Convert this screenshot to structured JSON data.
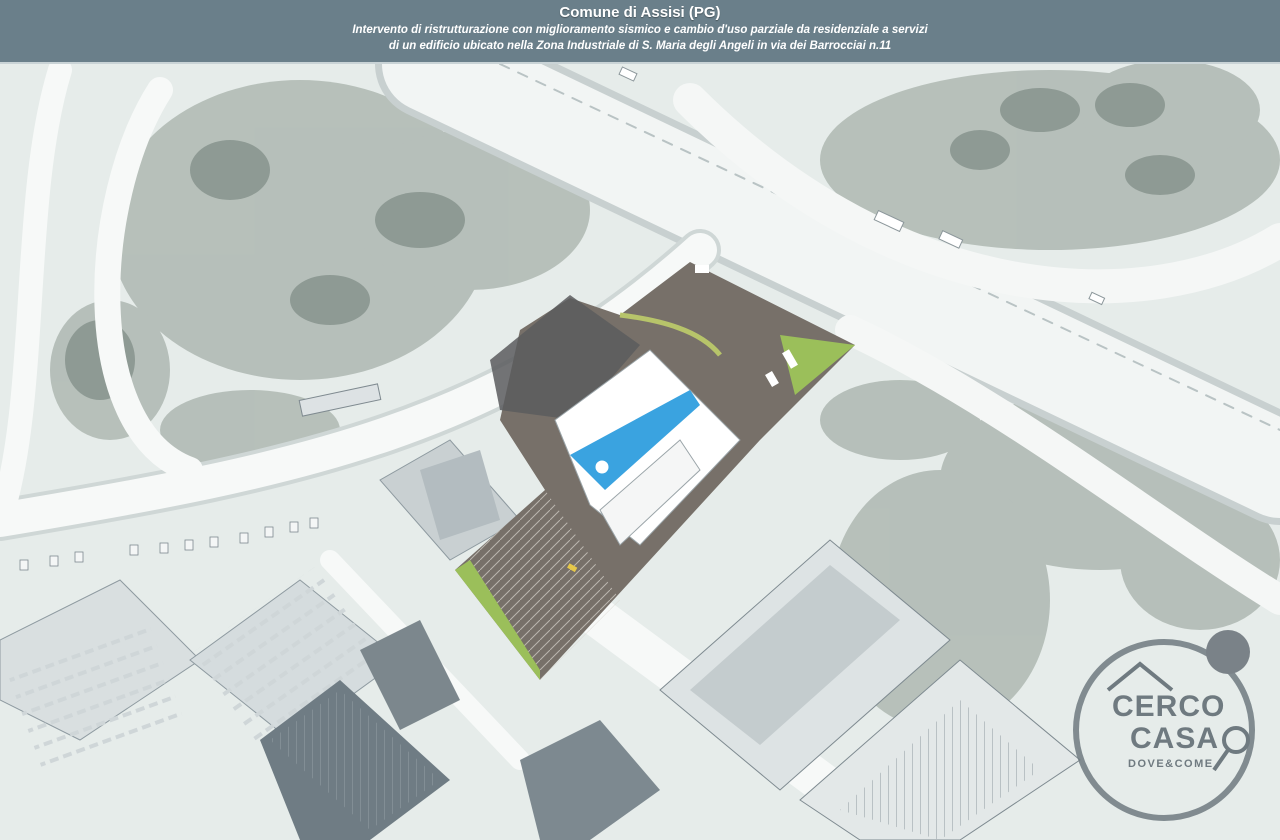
{
  "header": {
    "title": "Comune di Assisi (PG)",
    "subtitle_line1": "Intervento di ristrutturazione con miglioramento sismico e cambio d'uso parziale da residenziale a  servizi",
    "subtitle_line2": "di un edificio ubicato nella Zona Industriale di S. Maria degli Angeli in via dei Barrocciai n.11"
  },
  "watermark": {
    "brand_line1": "CERCO",
    "brand_line2": "CASA",
    "tagline": "DOVE&COME",
    "icon": "house-key-icon",
    "color": "#6f7a80"
  },
  "colors": {
    "header_bg": "#6a7f8a",
    "roof_white": "#ffffff",
    "roof_blue": "#3aa3e0",
    "parking_asphalt": "#767069",
    "green_strip": "#9bbf5a",
    "vegetation": "#a9b4ad",
    "road": "#f4f6f5"
  }
}
